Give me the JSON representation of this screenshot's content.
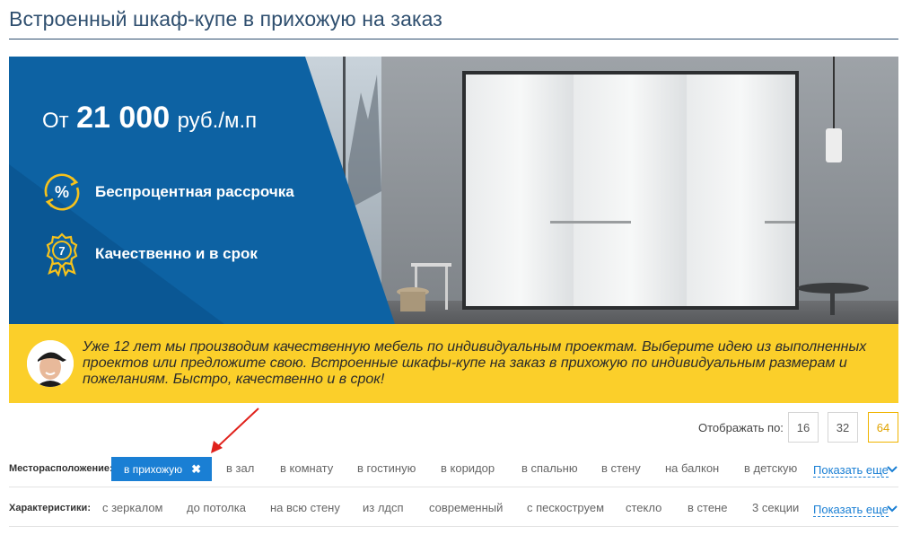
{
  "page": {
    "title": "Встроенный шкаф-купе в прихожую на заказ"
  },
  "banner": {
    "price_prefix": "От",
    "price_value": "21 000",
    "price_unit": "руб./м.п",
    "features": [
      {
        "icon": "percent-cycle-icon",
        "label": "Беспроцентная рассрочка"
      },
      {
        "icon": "award-badge-icon",
        "badge_number": "7",
        "label": "Качественно и в срок"
      }
    ]
  },
  "info": {
    "text": "Уже 12 лет мы производим качественную мебель по индивидуальным проектам. Выберите идею из выполненных проектов или предложите свою. Встроенные шкафы-купе на заказ в прихожую по индивидуальным размерам и пожеланиям. Быстро, качественно и в срок!"
  },
  "per_page": {
    "label": "Отображать по:",
    "options": [
      "16",
      "32",
      "64"
    ],
    "selected": "64"
  },
  "filters": {
    "location": {
      "label": "Месторасположение:",
      "active": "в прихожую",
      "items": [
        "в зал",
        "в комнату",
        "в гостиную",
        "в коридор",
        "в спальню",
        "в стену",
        "на балкон",
        "в детскую"
      ],
      "show_more": "Показать еще"
    },
    "features": {
      "label": "Характеристики:",
      "items": [
        "с зеркалом",
        "до потолка",
        "на всю стену",
        "из лдсп",
        "современный",
        "с пескоструем",
        "стекло",
        "в стене",
        "3 секции"
      ],
      "show_more": "Показать еще"
    }
  },
  "colors": {
    "accent_blue": "#1a7fd4",
    "banner_blue": "#0d62a3",
    "strip_yellow": "#fbcf2a",
    "active_perpage": "#f0b400",
    "arrow_red": "#e0211b"
  }
}
